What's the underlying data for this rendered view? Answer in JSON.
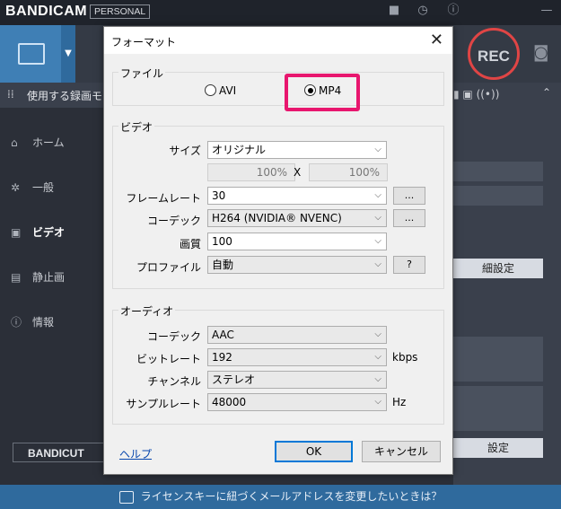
{
  "app": {
    "brand": "BANDICAM",
    "edition": "PERSONAL",
    "rec_label": "REC",
    "mode_label": "使用する録画モー",
    "nav": [
      "ホーム",
      "一般",
      "ビデオ",
      "静止画",
      "情報"
    ],
    "bandicut": "BANDICUT",
    "right_buttons": [
      "細設定",
      "設定"
    ],
    "status": "ライセンスキーに紐づくメールアドレスを変更したいときは？"
  },
  "dialog": {
    "title": "フォーマット",
    "file_group": "ファイル",
    "file_options": [
      "AVI",
      "MP4"
    ],
    "file_selected": "MP4",
    "video_group": "ビデオ",
    "video": {
      "size_label": "サイズ",
      "size_value": "オリジナル",
      "width_pct": "100%",
      "x_sep": "X",
      "height_pct": "100%",
      "fps_label": "フレームレート",
      "fps_value": "30",
      "codec_label": "コーデック",
      "codec_value": "H264 (NVIDIA® NVENC)",
      "quality_label": "画質",
      "quality_value": "100",
      "profile_label": "プロファイル",
      "profile_value": "自動",
      "more_button": "...",
      "help_button": "?"
    },
    "audio_group": "オーディオ",
    "audio": {
      "codec_label": "コーデック",
      "codec_value": "AAC",
      "bitrate_label": "ビットレート",
      "bitrate_value": "192",
      "bitrate_unit": "kbps",
      "channel_label": "チャンネル",
      "channel_value": "ステレオ",
      "sample_label": "サンプルレート",
      "sample_value": "48000",
      "sample_unit": "Hz"
    },
    "help_link": "ヘルプ",
    "ok": "OK",
    "cancel": "キャンセル"
  }
}
